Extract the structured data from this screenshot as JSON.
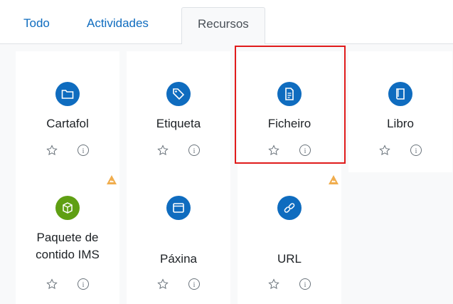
{
  "tabs": [
    {
      "label": "Todo"
    },
    {
      "label": "Actividades"
    },
    {
      "label": "Recursos",
      "active": true
    }
  ],
  "cards": [
    {
      "label": "Cartafol",
      "icon": "folder-icon",
      "color": "#0f6cbf"
    },
    {
      "label": "Etiqueta",
      "icon": "tag-icon",
      "color": "#0f6cbf"
    },
    {
      "label": "Ficheiro",
      "icon": "file-icon",
      "color": "#0f6cbf",
      "highlighted": true
    },
    {
      "label": "Libro",
      "icon": "book-icon",
      "color": "#0f6cbf"
    },
    {
      "label_line1": "Paquete de",
      "label_line2": "contido IMS",
      "icon": "package-icon",
      "color": "#5f9f13",
      "warning": true
    },
    {
      "label": "Páxina",
      "icon": "page-icon",
      "color": "#0f6cbf"
    },
    {
      "label": "URL",
      "icon": "link-icon",
      "color": "#0f6cbf",
      "warning": true
    }
  ],
  "colors": {
    "accent": "#0f6cbf",
    "highlight": "#e01b1b",
    "warning": "#f0ad4e",
    "package": "#5f9f13"
  }
}
